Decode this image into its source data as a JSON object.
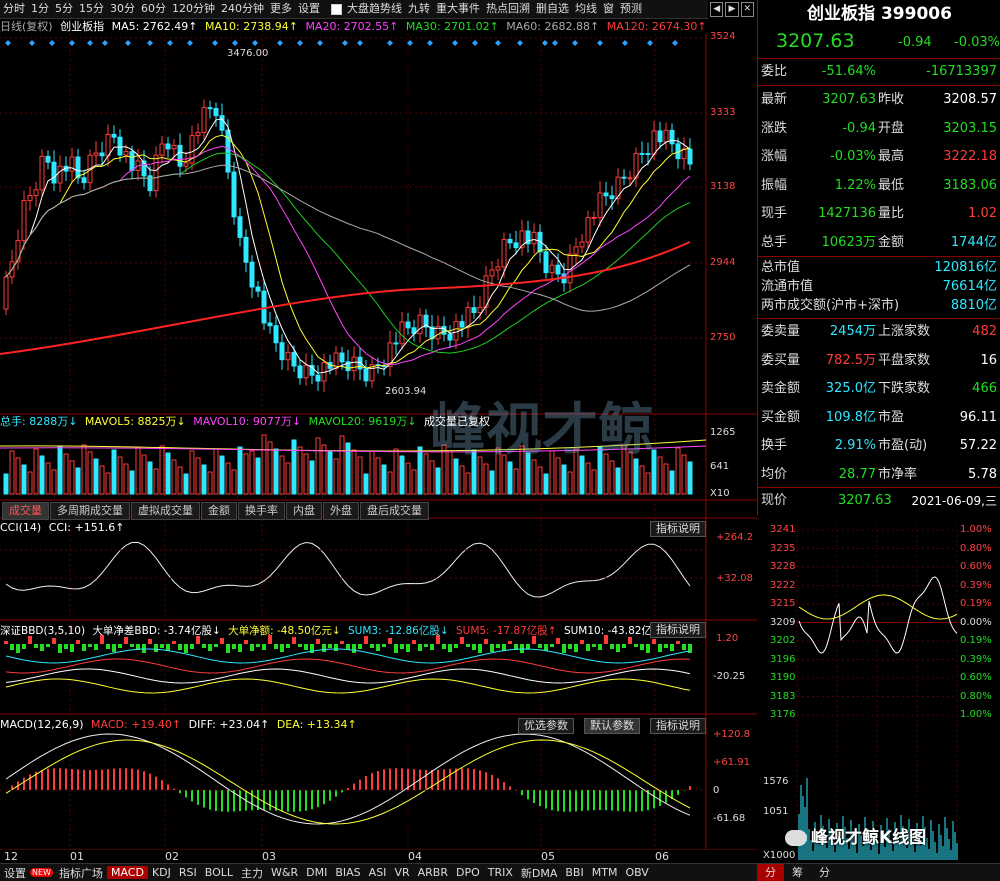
{
  "toolbar": {
    "periods": [
      "分时",
      "1分",
      "5分",
      "15分",
      "30分",
      "60分",
      "120分钟",
      "240分钟",
      "更多",
      "设置"
    ],
    "active_period": "日线",
    "trend_checkbox": "大盘趋势线",
    "items": [
      "九转",
      "重大事件",
      "热点回溯",
      "删自选",
      "均线",
      "窗",
      "预测"
    ]
  },
  "ma_line": {
    "prefix": "日线(复权)",
    "name": "创业板指",
    "ma5": "MA5: 2762.49↑",
    "ma10": "MA10: 2738.94↑",
    "ma20": "MA20: 2702.55↑",
    "ma30": "MA30: 2701.02↑",
    "ma60": "MA60: 2682.88↑",
    "ma120": "MA120: 2674.30↑"
  },
  "price_axis": [
    "3524",
    "3333",
    "3138",
    "2944",
    "2750"
  ],
  "price_annotations": {
    "high": "3476.00",
    "low": "2603.94"
  },
  "volume_line": {
    "total": "总手: 8288万↓",
    "mavol5": "MAVOL5: 8825万↓",
    "mavol10": "MAVOL10: 9077万↓",
    "mavol20": "MAVOL20: 9619万↓",
    "note": "成交量已复权"
  },
  "volume_axis": [
    "1265",
    "641",
    "X10"
  ],
  "indicator_tabs": [
    "成交量",
    "多周期成交量",
    "虚拟成交量",
    "金额",
    "换手率",
    "内盘",
    "外盘",
    "盘后成交量"
  ],
  "cci": {
    "label": "CCI(14)",
    "value": "CCI: +151.6↑",
    "axis": [
      "+264.2",
      "+32.08"
    ],
    "help": "指标说明"
  },
  "bbd": {
    "label": "深证BBD(3,5,10)",
    "bbd": "大单净差BBD: -3.74亿股↓",
    "net": "大单净额: -48.50亿元↓",
    "sum3": "SUM3: -12.86亿股↓",
    "sum5": "SUM5: -17.87亿股↑",
    "sum10": "SUM10: -43.82亿股↑",
    "axis": [
      "1.20",
      "-20.25"
    ],
    "help": "指标说明"
  },
  "macd": {
    "label": "MACD(12,26,9)",
    "macd": "MACD: +19.40↑",
    "diff": "DIFF: +23.04↑",
    "dea": "DEA: +13.34↑",
    "axis": [
      "+120.8",
      "+61.91",
      "0",
      "-61.68"
    ],
    "btn_opt": "优选参数",
    "btn_default": "默认参数",
    "help": "指标说明"
  },
  "date_axis": [
    "12",
    "01",
    "02",
    "03",
    "04",
    "05",
    "06"
  ],
  "bottom_tabs": [
    "设置",
    "指标广场",
    "MACD",
    "KDJ",
    "RSI",
    "BOLL",
    "主力",
    "W&R",
    "DMI",
    "BIAS",
    "ASI",
    "VR",
    "ARBR",
    "DPO",
    "TRIX",
    "新DMA",
    "BBI",
    "MTM",
    "OBV"
  ],
  "bottom_new": "NEW",
  "bottom_active": "MACD",
  "quote": {
    "title": "创业板指  399006",
    "price": "3207.63",
    "change": "-0.94",
    "pct": "-0.03%",
    "weibi_label": "委比",
    "weibi": "-51.64%",
    "weicha": "-16713397",
    "rows": [
      [
        "最新",
        "3207.63",
        "昨收",
        "3208.57"
      ],
      [
        "涨跌",
        "-0.94",
        "开盘",
        "3203.15"
      ],
      [
        "涨幅",
        "-0.03%",
        "最高",
        "3222.18"
      ],
      [
        "振幅",
        "1.22%",
        "最低",
        "3183.06"
      ],
      [
        "现手",
        "1427136",
        "量比",
        "1.02"
      ],
      [
        "总手",
        "10623万",
        "金额",
        "1744亿"
      ]
    ],
    "cap_rows": [
      [
        "总市值",
        "120816亿"
      ],
      [
        "流通市值",
        "76614亿"
      ],
      [
        "两市成交额(沪市+深市)",
        "8810亿"
      ]
    ],
    "rows2": [
      [
        "委卖量",
        "2454万",
        "上涨家数",
        "482"
      ],
      [
        "委买量",
        "782.5万",
        "平盘家数",
        "16"
      ],
      [
        "卖金额",
        "325.0亿",
        "下跌家数",
        "466"
      ],
      [
        "买金额",
        "109.8亿",
        "市盈",
        "96.11"
      ],
      [
        "换手",
        "2.91%",
        "市盈(动)",
        "57.22"
      ],
      [
        "均价",
        "28.77",
        "市净率",
        "5.78"
      ]
    ],
    "last_label": "现价",
    "last": "3207.63",
    "date": "2021-06-09,三"
  },
  "intraday": {
    "left_axis": [
      "3241",
      "3235",
      "3228",
      "3222",
      "3215",
      "3209",
      "3202",
      "3196",
      "3190",
      "3183",
      "3176"
    ],
    "right_axis": [
      "1.00%",
      "0.80%",
      "0.60%",
      "0.39%",
      "0.19%",
      "0.00%",
      "0.19%",
      "0.39%",
      "0.60%",
      "0.80%",
      "1.00%"
    ],
    "vol_axis": [
      "1576",
      "1051",
      "X1000"
    ],
    "tabs": [
      "分",
      "筹",
      "分"
    ]
  },
  "watermark": {
    "main": "峰视才鲸",
    "brand": "峰视才鲸K线图"
  },
  "colors": {
    "up": "#ff3b3b",
    "down": "#2ee8ff",
    "ma120": "#ff2222",
    "accent_red": "#aa0000"
  }
}
